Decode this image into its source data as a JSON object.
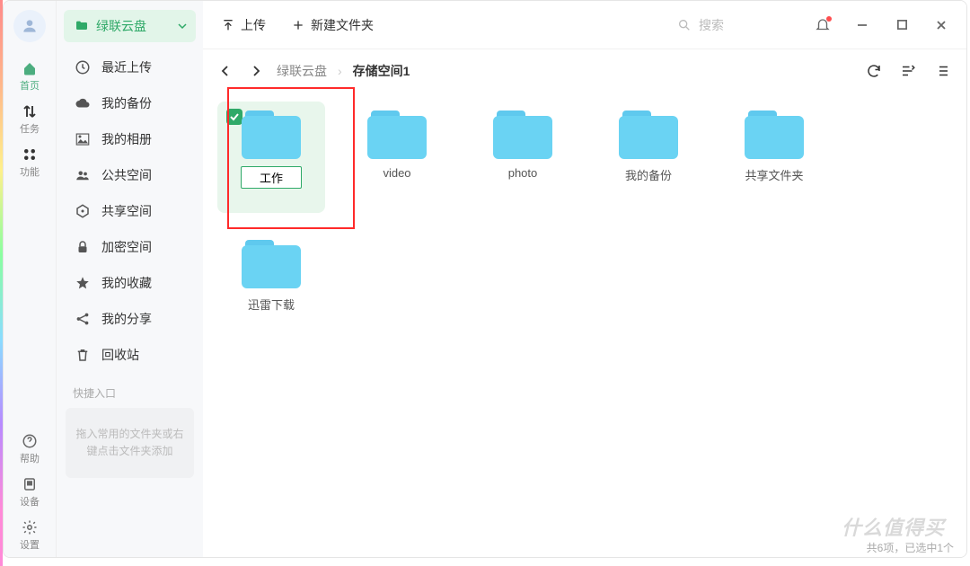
{
  "nav_rail": [
    {
      "key": "home",
      "label": "首页",
      "active": true
    },
    {
      "key": "tasks",
      "label": "任务",
      "active": false
    },
    {
      "key": "features",
      "label": "功能",
      "active": false
    }
  ],
  "nav_bottom": [
    {
      "key": "help",
      "label": "帮助"
    },
    {
      "key": "device",
      "label": "设备"
    },
    {
      "key": "settings",
      "label": "设置"
    }
  ],
  "sidebar": {
    "dropdown_label": "绿联云盘",
    "items": [
      {
        "icon": "clock",
        "label": "最近上传"
      },
      {
        "icon": "cloud",
        "label": "我的备份"
      },
      {
        "icon": "image",
        "label": "我的相册"
      },
      {
        "icon": "group",
        "label": "公共空间"
      },
      {
        "icon": "share",
        "label": "共享空间"
      },
      {
        "icon": "lock",
        "label": "加密空间"
      },
      {
        "icon": "star",
        "label": "我的收藏"
      },
      {
        "icon": "sharealt",
        "label": "我的分享"
      },
      {
        "icon": "trash",
        "label": "回收站"
      }
    ],
    "quick_title": "快捷入口",
    "dropzone_text": "拖入常用的文件夹或右键点击文件夹添加"
  },
  "toolbar": {
    "upload": "上传",
    "new_folder": "新建文件夹",
    "search_placeholder": "搜索"
  },
  "breadcrumb": {
    "root": "绿联云盘",
    "current": "存储空间1"
  },
  "files": [
    {
      "name": "工作",
      "selected": true,
      "editing": true
    },
    {
      "name": "video",
      "selected": false
    },
    {
      "name": "photo",
      "selected": false
    },
    {
      "name": "我的备份",
      "selected": false
    },
    {
      "name": "共享文件夹",
      "selected": false
    },
    {
      "name": "迅雷下载",
      "selected": false
    }
  ],
  "status": "共6项，已选中1个",
  "watermark": "什么值得买"
}
